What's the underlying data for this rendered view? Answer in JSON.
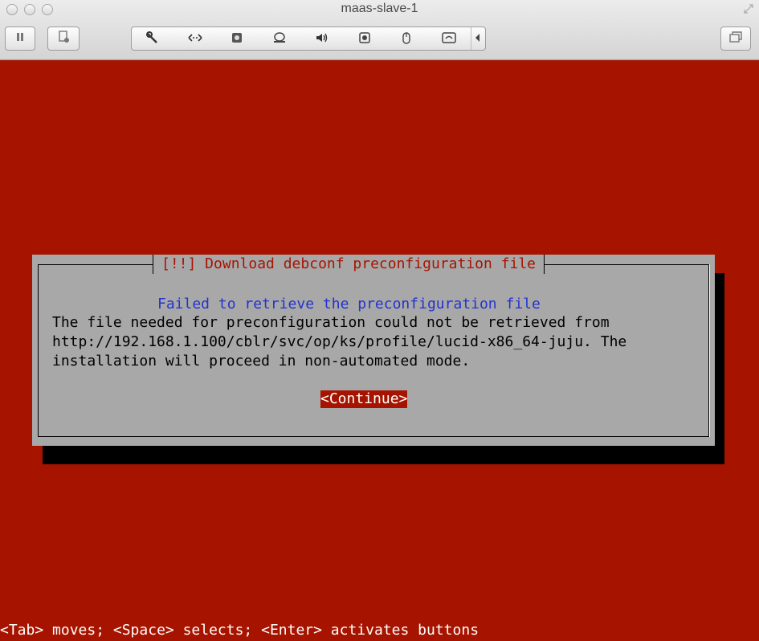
{
  "window": {
    "title": "maas-slave-1"
  },
  "toolbar": {
    "pause_icon": "pause-icon",
    "snapshot_icon": "snapshot-icon",
    "settings_icon": "wrench-icon",
    "network_icon": "network-icon",
    "disk_icon": "hard-disk-icon",
    "cd_icon": "cd-eject-icon",
    "sound_icon": "speaker-icon",
    "camera_icon": "camera-icon",
    "usb_icon": "mouse-icon",
    "share_icon": "shared-folder-icon",
    "more_icon": "chevron-left-icon",
    "fullscreen_icon": "fullscreen-icon"
  },
  "dialog": {
    "title": "[!!] Download debconf preconfiguration file",
    "heading": "Failed to retrieve the preconfiguration file",
    "lines": [
      "The file needed for preconfiguration could not be retrieved from",
      "http://192.168.1.100/cblr/svc/op/ks/profile/lucid-x86_64-juju. The",
      "installation will proceed in non-automated mode."
    ],
    "button": "<Continue>"
  },
  "status": "<Tab> moves; <Space> selects; <Enter> activates buttons",
  "colors": {
    "background": "#a61400",
    "dialog": "#a8a8a8",
    "heading": "#2233cc",
    "shadow": "#000000"
  }
}
